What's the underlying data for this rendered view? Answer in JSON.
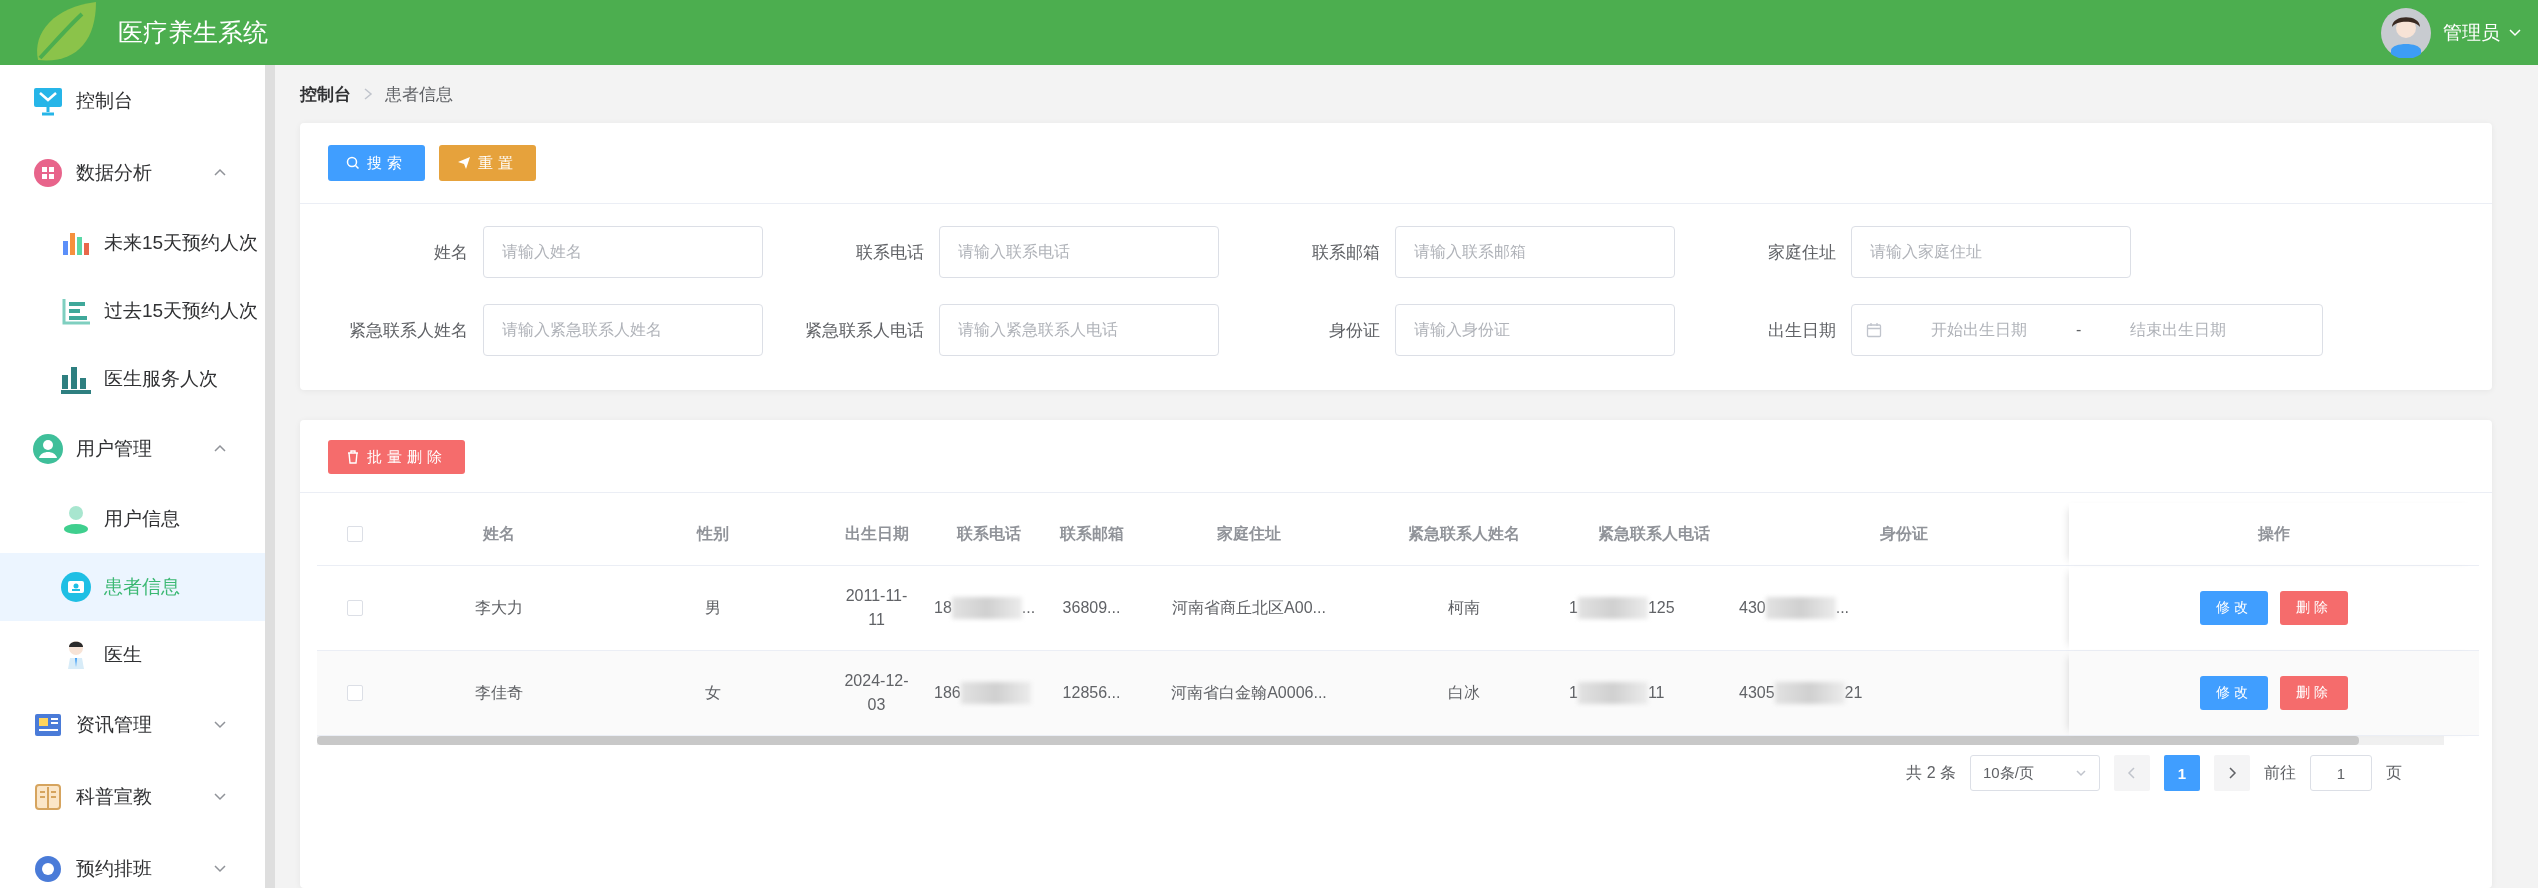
{
  "header": {
    "title": "医疗养生系统",
    "user": "管理员"
  },
  "sidebar": {
    "items": [
      {
        "label": "控制台",
        "kind": "link",
        "selected": false
      },
      {
        "label": "数据分析",
        "kind": "group",
        "expanded": true,
        "selected": false,
        "children": [
          {
            "label": "未来15天预约人次",
            "selected": false
          },
          {
            "label": "过去15天预约人次",
            "selected": false
          },
          {
            "label": "医生服务人次",
            "selected": false
          }
        ]
      },
      {
        "label": "用户管理",
        "kind": "group",
        "expanded": true,
        "selected": false,
        "children": [
          {
            "label": "用户信息",
            "selected": false
          },
          {
            "label": "患者信息",
            "selected": true
          },
          {
            "label": "医生",
            "selected": false
          }
        ]
      },
      {
        "label": "资讯管理",
        "kind": "group",
        "expanded": false,
        "selected": false
      },
      {
        "label": "科普宣教",
        "kind": "group",
        "expanded": false,
        "selected": false
      },
      {
        "label": "预约排班",
        "kind": "group",
        "expanded": false,
        "selected": false
      }
    ]
  },
  "breadcrumb": [
    "控制台",
    "患者信息"
  ],
  "search": {
    "buttons": [
      "搜索",
      "重置"
    ],
    "fields": [
      {
        "kind": "text",
        "label": "姓名",
        "placeholder": "请输入姓名"
      },
      {
        "kind": "text",
        "label": "联系电话",
        "placeholder": "请输入联系电话"
      },
      {
        "kind": "text",
        "label": "联系邮箱",
        "placeholder": "请输入联系邮箱"
      },
      {
        "kind": "text",
        "label": "家庭住址",
        "placeholder": "请输入家庭住址"
      },
      {
        "kind": "text",
        "label": "紧急联系人姓名",
        "placeholder": "请输入紧急联系人姓名"
      },
      {
        "kind": "text",
        "label": "紧急联系人电话",
        "placeholder": "请输入紧急联系人电话"
      },
      {
        "kind": "text",
        "label": "身份证",
        "placeholder": "请输入身份证"
      },
      {
        "kind": "date-range",
        "label": "出生日期",
        "start_placeholder": "开始出生日期",
        "separator": "-",
        "end_placeholder": "结束出生日期"
      }
    ]
  },
  "table": {
    "toolbar_button": "批量删除",
    "select_all_checked": false,
    "columns": [
      "姓名",
      "性别",
      "出生日期",
      "联系电话",
      "联系邮箱",
      "家庭住址",
      "紧急联系人姓名",
      "紧急联系人电话",
      "身份证",
      "操作"
    ],
    "rows": [
      {
        "checked": false,
        "cells": [
          "李大力",
          "男",
          "2011-11-11",
          {
            "kind": "redacted",
            "before": "18",
            "after": "..."
          },
          "36809...",
          "河南省商丘北区A00...",
          "柯南",
          {
            "kind": "redacted",
            "before": "1",
            "after": "125"
          },
          {
            "kind": "redacted",
            "before": "430",
            "after": "..."
          }
        ],
        "actions": [
          "修改",
          "删除"
        ]
      },
      {
        "checked": false,
        "cells": [
          "李佳奇",
          "女",
          "2024-12-03",
          {
            "kind": "redacted",
            "before": "186"
          },
          "12856...",
          "河南省白金翰A0006...",
          "白冰",
          {
            "kind": "redacted",
            "before": "1",
            "after": "11"
          },
          {
            "kind": "redacted",
            "before": "4305",
            "after": "21"
          }
        ],
        "actions": [
          "修改",
          "删除"
        ]
      }
    ]
  },
  "pagination": {
    "total": "共 2 条",
    "page_size": "10条/页",
    "pages": [
      {
        "label": "1",
        "selected": true
      }
    ],
    "goto_label": "前往",
    "goto_value": "1",
    "goto_suffix": "页"
  }
}
